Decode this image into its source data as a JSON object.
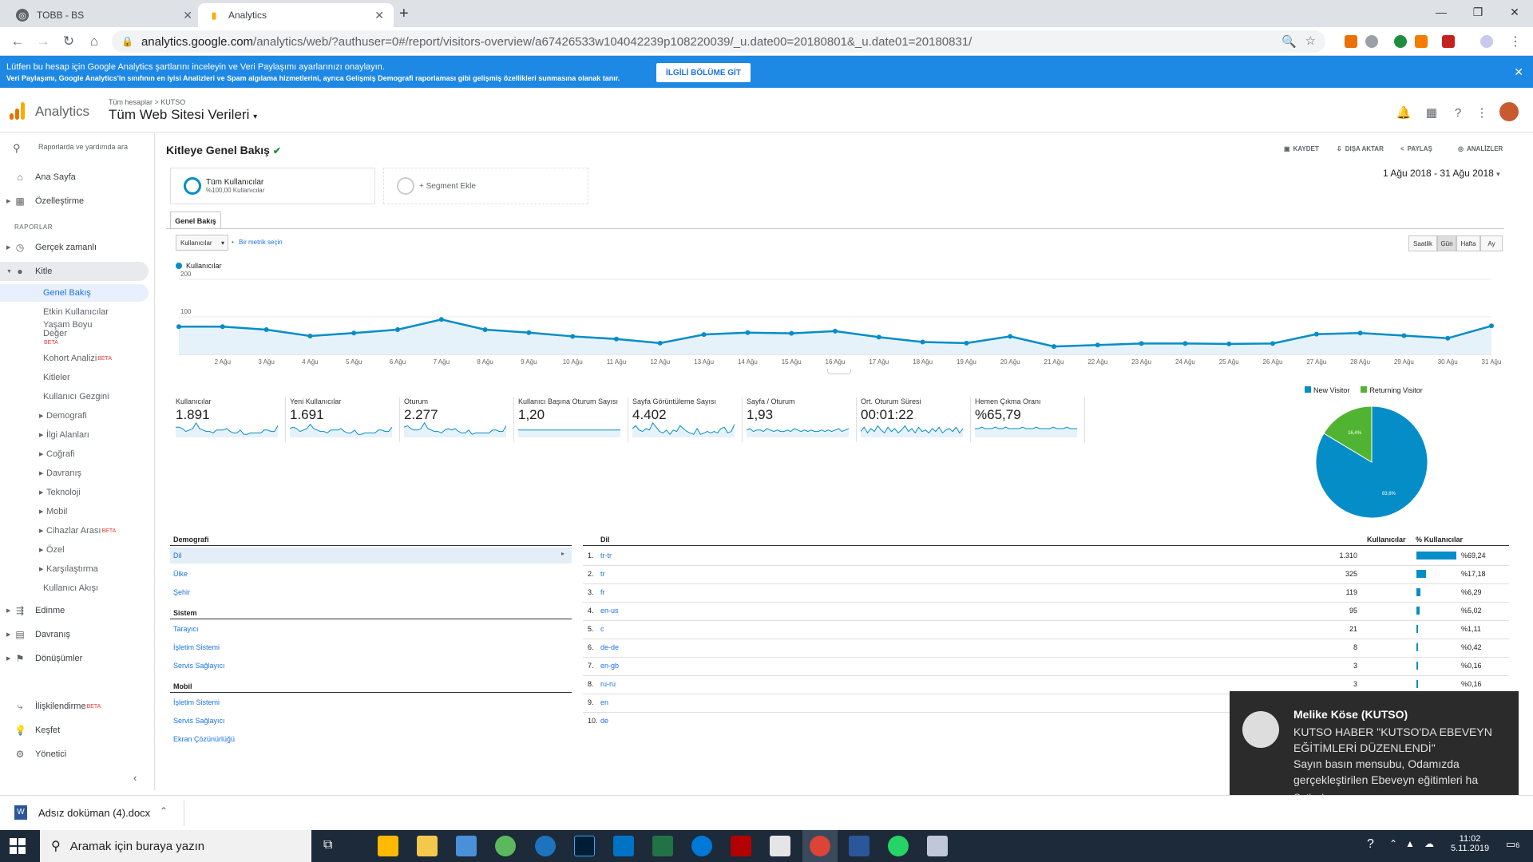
{
  "browser": {
    "tabs": [
      {
        "title": "TOBB - BS"
      },
      {
        "title": "Analytics"
      }
    ],
    "url_host": "analytics.google.com",
    "url_path": "/analytics/web/?authuser=0#/report/visitors-overview/a67426533w104042239p108220039/_u.date00=20180801&_u.date01=20180831/"
  },
  "notice": {
    "line1": "Lütfen bu hesap için Google Analytics şartlarını inceleyin ve Veri Paylaşımı ayarlarınızı onaylayın.",
    "line2": "Veri Paylaşımı, Google Analytics'in sınıfının en iyisi Analizleri ve Spam algılama hizmetlerini, ayrıca Gelişmiş Demografi raporlaması gibi gelişmiş özellikleri sunmasına olanak tanır.",
    "button": "İLGİLİ BÖLÜME GİT"
  },
  "header": {
    "brand": "Analytics",
    "crumb": "Tüm hesaplar > KUTSO",
    "property": "Tüm Web Sitesi Verileri"
  },
  "sidebar": {
    "search": "Raporlarda ve yardımda ara",
    "home": "Ana Sayfa",
    "custom": "Özelleştirme",
    "section": "RAPORLAR",
    "realtime": "Gerçek zamanlı",
    "audience": "Kitle",
    "audience_sub": [
      "Genel Bakış",
      "Etkin Kullanıcılar",
      "Yaşam Boyu Değer",
      "Kohort Analizi",
      "Kitleler",
      "Kullanıcı Gezgini",
      "Demografi",
      "İlgi Alanları",
      "Coğrafi",
      "Davranış",
      "Teknoloji",
      "Mobil",
      "Cihazlar Arası",
      "Özel",
      "Karşılaştırma",
      "Kullanıcı Akışı"
    ],
    "beta": "BETA",
    "acquisition": "Edinme",
    "behavior": "Davranış",
    "conversions": "Dönüşümler",
    "attribution": "İlişkilendirme",
    "discover": "Keşfet",
    "admin": "Yönetici"
  },
  "main": {
    "title": "Kitleye Genel Bakış",
    "actions": [
      "KAYDET",
      "DIŞA AKTAR",
      "PAYLAŞ",
      "ANALİZLER"
    ],
    "segment_name": "Tüm Kullanıcılar",
    "segment_pct": "%100,00 Kullanıcılar",
    "segment_add": "+ Segment Ekle",
    "date_range": "1 Ağu 2018 - 31 Ağu 2018",
    "tab": "Genel Bakış",
    "metric": "Kullanıcılar",
    "metric_vs": "Bir metrik seçin",
    "granularity": [
      "Saatlik",
      "Gün",
      "Hafta",
      "Ay"
    ],
    "legend": "Kullanıcılar"
  },
  "chart_data": [
    {
      "type": "line",
      "series": [
        {
          "name": "Kullanıcılar",
          "values": [
            74,
            74,
            66,
            49,
            57,
            66,
            93,
            66,
            58,
            48,
            41,
            30,
            53,
            58,
            56,
            62,
            46,
            33,
            30,
            48,
            21,
            25,
            29,
            29,
            28,
            29,
            54,
            57,
            50,
            43,
            76
          ]
        }
      ],
      "x": [
        "1 Ağu",
        "2 Ağu",
        "3 Ağu",
        "4 Ağu",
        "5 Ağu",
        "6 Ağu",
        "7 Ağu",
        "8 Ağu",
        "9 Ağu",
        "10 Ağu",
        "11 Ağu",
        "12 Ağu",
        "13 Ağu",
        "14 Ağu",
        "15 Ağu",
        "16 Ağu",
        "17 Ağu",
        "18 Ağu",
        "19 Ağu",
        "20 Ağu",
        "21 Ağu",
        "22 Ağu",
        "23 Ağu",
        "24 Ağu",
        "25 Ağu",
        "26 Ağu",
        "27 Ağu",
        "28 Ağu",
        "29 Ağu",
        "30 Ağu",
        "31 Ağu"
      ],
      "x_ticks": [
        "2 Ağu",
        "3 Ağu",
        "4 Ağu",
        "5 Ağu",
        "6 Ağu",
        "7 Ağu",
        "8 Ağu",
        "9 Ağu",
        "10 Ağu",
        "11 Ağu",
        "12 Ağu",
        "13 Ağu",
        "14 Ağu",
        "15 Ağu",
        "16 Ağu",
        "17 Ağu",
        "18 Ağu",
        "19 Ağu",
        "20 Ağu",
        "21 Ağu",
        "22 Ağu",
        "23 Ağu",
        "24 Ağu",
        "25 Ağu",
        "26 Ağu",
        "27 Ağu",
        "28 Ağu",
        "29 Ağu",
        "30 Ağu",
        "31 Ağu"
      ],
      "y_ticks": [
        "100",
        "200"
      ],
      "ylim": [
        0,
        200
      ]
    },
    {
      "type": "pie",
      "categories": [
        "New Visitor",
        "Returning Visitor"
      ],
      "values": [
        83.6,
        16.4
      ],
      "labels": [
        "83,6%",
        "16,4%"
      ],
      "colors": [
        "#058dc7",
        "#50b432"
      ]
    }
  ],
  "kpis": [
    {
      "label": "Kullanıcılar",
      "value": "1.891"
    },
    {
      "label": "Yeni Kullanıcılar",
      "value": "1.691"
    },
    {
      "label": "Oturum",
      "value": "2.277"
    },
    {
      "label": "Kullanıcı Başına Oturum Sayısı",
      "value": "1,20"
    },
    {
      "label": "Sayfa Görüntüleme Sayısı",
      "value": "4.402"
    },
    {
      "label": "Sayfa / Oturum",
      "value": "1,93"
    },
    {
      "label": "Ort. Oturum Süresi",
      "value": "00:01:22"
    },
    {
      "label": "Hemen Çıkma Oranı",
      "value": "%65,79"
    }
  ],
  "dims": {
    "demografi": "Demografi",
    "demografi_items": [
      "Dil",
      "Ülke",
      "Şehir"
    ],
    "sistem": "Sistem",
    "sistem_items": [
      "Tarayıcı",
      "İşletim Sistemi",
      "Servis Sağlayıcı"
    ],
    "mobil": "Mobil",
    "mobil_items": [
      "İşletim Sistemi",
      "Servis Sağlayıcı",
      "Ekran Çözünürlüğü"
    ]
  },
  "lang_table": {
    "col_dim": "Dil",
    "col_users": "Kullanıcılar",
    "col_pct": "% Kullanıcılar",
    "rows": [
      {
        "rank": "1.",
        "lang": "tr-tr",
        "users": "1.310",
        "pct": "%69,24",
        "frac": 0.6924
      },
      {
        "rank": "2.",
        "lang": "tr",
        "users": "325",
        "pct": "%17,18",
        "frac": 0.1718
      },
      {
        "rank": "3.",
        "lang": "fr",
        "users": "119",
        "pct": "%6,29",
        "frac": 0.0629
      },
      {
        "rank": "4.",
        "lang": "en-us",
        "users": "95",
        "pct": "%5,02",
        "frac": 0.0502
      },
      {
        "rank": "5.",
        "lang": "c",
        "users": "21",
        "pct": "%1,11",
        "frac": 0.0111
      },
      {
        "rank": "6.",
        "lang": "de-de",
        "users": "8",
        "pct": "%0,42",
        "frac": 0.0042
      },
      {
        "rank": "7.",
        "lang": "en-gb",
        "users": "3",
        "pct": "%0,16",
        "frac": 0.0016
      },
      {
        "rank": "8.",
        "lang": "ru-ru",
        "users": "3",
        "pct": "%0,16",
        "frac": 0.0016
      },
      {
        "rank": "9.",
        "lang": "en",
        "users": "",
        "pct": "",
        "frac": 0
      },
      {
        "rank": "10.",
        "lang": "de",
        "users": "",
        "pct": "",
        "frac": 0
      }
    ]
  },
  "toast": {
    "title": "Melike Köse (KUTSO)",
    "body1": "KUTSO HABER \"KUTSO'DA EBEVEYN EĞİTİMLERİ DÜZENLENDİ\"",
    "body2": "Sayın basın mensubu,   Odamızda gerçekleştirilen Ebeveyn eğitimleri ha",
    "source": "Outlook"
  },
  "download": {
    "file": "Adsız doküman (4).docx"
  },
  "taskbar": {
    "search": "Aramak için buraya yazın",
    "time": "11:02",
    "date": "5.11.2019",
    "notif_count": "6"
  }
}
